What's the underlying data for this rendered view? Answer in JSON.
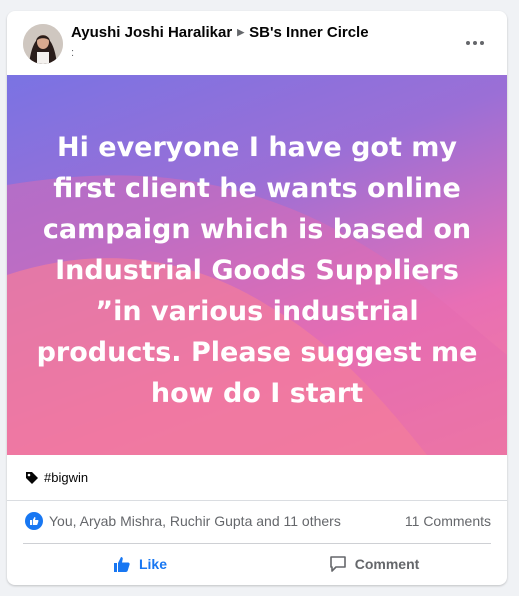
{
  "post": {
    "author": "Ayushi Joshi Haralikar",
    "group": "SB's Inner Circle",
    "meta": ":",
    "body_text": "Hi everyone I have got my first client he wants online campaign which is based on Industrial Goods Suppliers ”in various industrial products. Please suggest me how do I start",
    "hashtag": "#bigwin"
  },
  "reactions": {
    "summary": "You, Aryab Mishra, Ruchir Gupta and 11 others",
    "comments_count": "11 Comments"
  },
  "actions": {
    "like_label": "Like",
    "comment_label": "Comment"
  },
  "icons": {
    "more": "more-horizontal-icon",
    "tag": "tag-icon",
    "like_badge": "thumbs-up-icon",
    "like": "thumbs-up-icon",
    "comment": "comment-bubble-icon"
  },
  "colors": {
    "accent": "#1877f2",
    "background": "#f0f2f5",
    "banner_top": "#7a73e3",
    "banner_bottom": "#f27d9c"
  }
}
